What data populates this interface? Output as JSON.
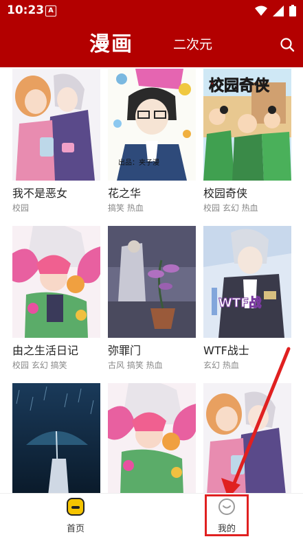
{
  "status": {
    "time": "10:23",
    "notif_glyph": "A"
  },
  "header": {
    "tab_active": "漫画",
    "tab_inactive": "二次元",
    "search_icon": "search-icon",
    "bg": "#b30000"
  },
  "comics": [
    {
      "title": "我不是恶女",
      "tags": "校园"
    },
    {
      "title": "花之华",
      "tags": "搞笑 热血"
    },
    {
      "title": "校园奇侠",
      "tags": "校园 玄幻 热血"
    },
    {
      "title": "由之生活日记",
      "tags": "校园 玄幻 搞笑"
    },
    {
      "title": "弥罪门",
      "tags": "古风 搞笑 热血"
    },
    {
      "title": "WTF战士",
      "tags": "玄幻 热血"
    },
    {
      "title": "",
      "tags": ""
    },
    {
      "title": "",
      "tags": ""
    },
    {
      "title": "",
      "tags": ""
    }
  ],
  "cover_text": {
    "c2_caption": "出品：夹子漫",
    "c3_logo": "校园奇侠",
    "c6_logo": "WTF战"
  },
  "bottom_nav": {
    "home_label": "首页",
    "mine_label": "我的",
    "home_icon": "home-icon",
    "mine_icon": "smile-icon"
  },
  "annotation_color": "#e02020"
}
